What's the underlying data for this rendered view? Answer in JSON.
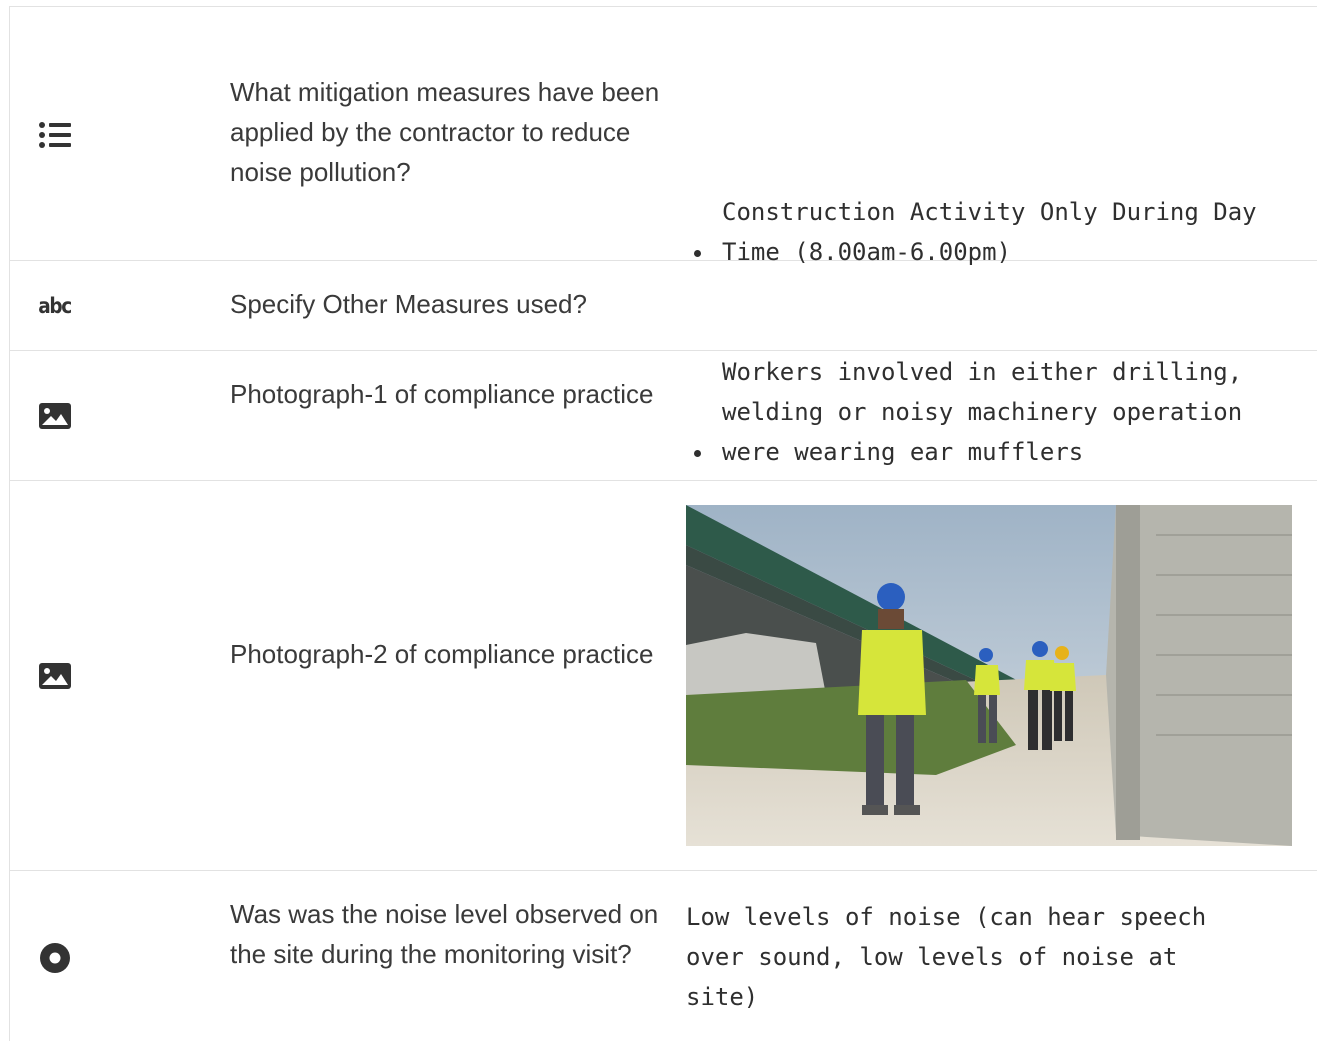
{
  "rows": [
    {
      "icon": "list-icon",
      "question": "What mitigation measures have been applied by the contractor to reduce noise pollution?",
      "answers": [
        "Construction Activity Only During Day\nTime (8.00am-6.00pm)",
        "Workers involved in either drilling,\nwelding or noisy machinery operation\nwere wearing ear mufflers"
      ]
    },
    {
      "icon": "text-icon",
      "icon_text": "abc",
      "question": "Specify Other Measures used?",
      "answer": ""
    },
    {
      "icon": "image-icon",
      "question": "Photograph-1 of compliance practice",
      "answer": ""
    },
    {
      "icon": "image-icon",
      "question": "Photograph-2 of compliance practice",
      "photo": "construction-site-workers-photo"
    },
    {
      "icon": "radio-icon",
      "question": "Was was the noise level observed on the site during the monitoring visit?",
      "answer": "Low levels of noise (can hear speech\nover sound, low levels of noise at\nsite)"
    }
  ],
  "colors": {
    "border": "#e2e2e2",
    "text": "#333333"
  }
}
